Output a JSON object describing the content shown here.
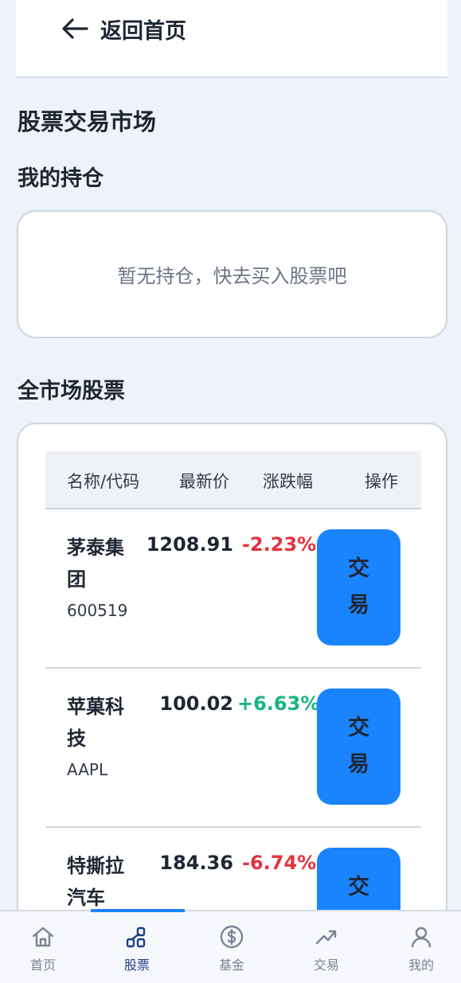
{
  "header": {
    "back_label": "返回首页"
  },
  "page_title": "股票交易市场",
  "holdings": {
    "title": "我的持仓",
    "empty_text": "暂无持仓，快去买入股票吧"
  },
  "market": {
    "title": "全市场股票",
    "columns": [
      "名称/代码",
      "最新价",
      "涨跌幅",
      "操作"
    ],
    "rows": [
      {
        "name": "茅泰集团",
        "code": "600519",
        "price": "1208.91",
        "change": "-2.23%",
        "action": "交易"
      },
      {
        "name": "苹菓科技",
        "code": "AAPL",
        "price": "100.02",
        "change": "+6.63%",
        "action": "交易"
      },
      {
        "name": "特撕拉汽车",
        "code": "",
        "price": "184.36",
        "change": "-6.74%",
        "action": "交易"
      }
    ]
  },
  "colors": {
    "accent": "#1a84ff",
    "down": "#e5323e",
    "up": "#16b383",
    "background": "#eef3f9"
  },
  "tabbar": {
    "items": [
      {
        "label": "首页",
        "icon": "home-icon"
      },
      {
        "label": "股票",
        "icon": "stock-chart-icon",
        "active": true
      },
      {
        "label": "基金",
        "icon": "dollar-coin-icon"
      },
      {
        "label": "交易",
        "icon": "trend-icon"
      },
      {
        "label": "我的",
        "icon": "user-icon"
      }
    ]
  }
}
